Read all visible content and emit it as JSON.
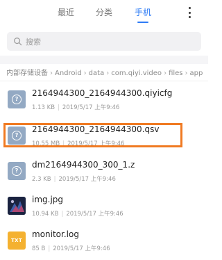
{
  "tabs": {
    "recent": "最近",
    "category": "分类",
    "phone": "手机",
    "active": "phone"
  },
  "search": {
    "placeholder": "搜索"
  },
  "breadcrumb": [
    "内部存储设备",
    "Android",
    "data",
    "com.qiyi.video",
    "files",
    "app"
  ],
  "files": [
    {
      "name": "2164944300_2164944300.qiyicfg",
      "size": "1.13 KB",
      "date": "2019/5/17 上午9:46",
      "icon": "unknown-file-icon"
    },
    {
      "name": "2164944300_2164944300.qsv",
      "size": "10.55 MB",
      "date": "2019/5/17 上午9:46",
      "icon": "unknown-file-icon",
      "highlighted": true
    },
    {
      "name": "dm2164944300_300_1.z",
      "size": "2.3 KB",
      "date": "2019/5/17 上午9:46",
      "icon": "unknown-file-icon"
    },
    {
      "name": "img.jpg",
      "size": "10.94 KB",
      "date": "2019/5/17 上午9:46",
      "icon": "image-thumbnail-icon"
    },
    {
      "name": "monitor.log",
      "size": "85 B",
      "date": "2019/5/17 上午9:46",
      "icon": "txt-file-icon",
      "icon_text": "TXT"
    }
  ],
  "colors": {
    "accent": "#2e7cf6",
    "highlight": "#f07a22"
  }
}
